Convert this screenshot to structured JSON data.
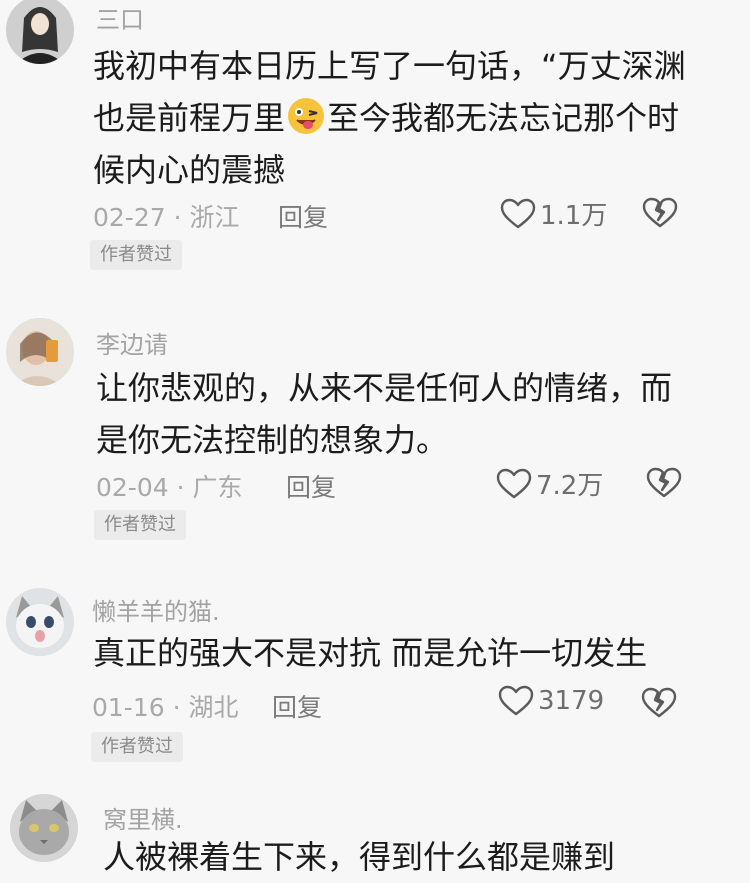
{
  "comments": [
    {
      "username": "三口",
      "lines": [
        "我初中有本日历上写了一句话，“万丈深渊",
        "也是前程万里",
        "至今我都无法忘记那个时",
        "候内心的震撼"
      ],
      "emoji": "winking-tongue-emoji",
      "date": "02-27 · 浙江",
      "reply": "回复",
      "likes": "1.1万",
      "badge": "作者赞过"
    },
    {
      "username": "李边请",
      "lines": [
        "让你悲观的，从来不是任何人的情绪，而",
        "是你无法控制的想象力。"
      ],
      "date": "02-04 · 广东",
      "reply": "回复",
      "likes": "7.2万",
      "badge": "作者赞过"
    },
    {
      "username": "懒羊羊的猫.",
      "lines": [
        "真正的强大不是对抗 而是允许一切发生"
      ],
      "date": "01-16 · 湖北",
      "reply": "回复",
      "likes": "3179",
      "badge": "作者赞过"
    },
    {
      "username": "窝里横.",
      "lines": [
        "人被裸着生下来，得到什么都是赚到"
      ]
    }
  ],
  "icons": {
    "like": "heart-outline-icon",
    "dislike": "broken-heart-icon"
  },
  "colors": {
    "background": "#f7f7f7",
    "text": "#1c1c1c",
    "muted": "#a9a9a9"
  }
}
